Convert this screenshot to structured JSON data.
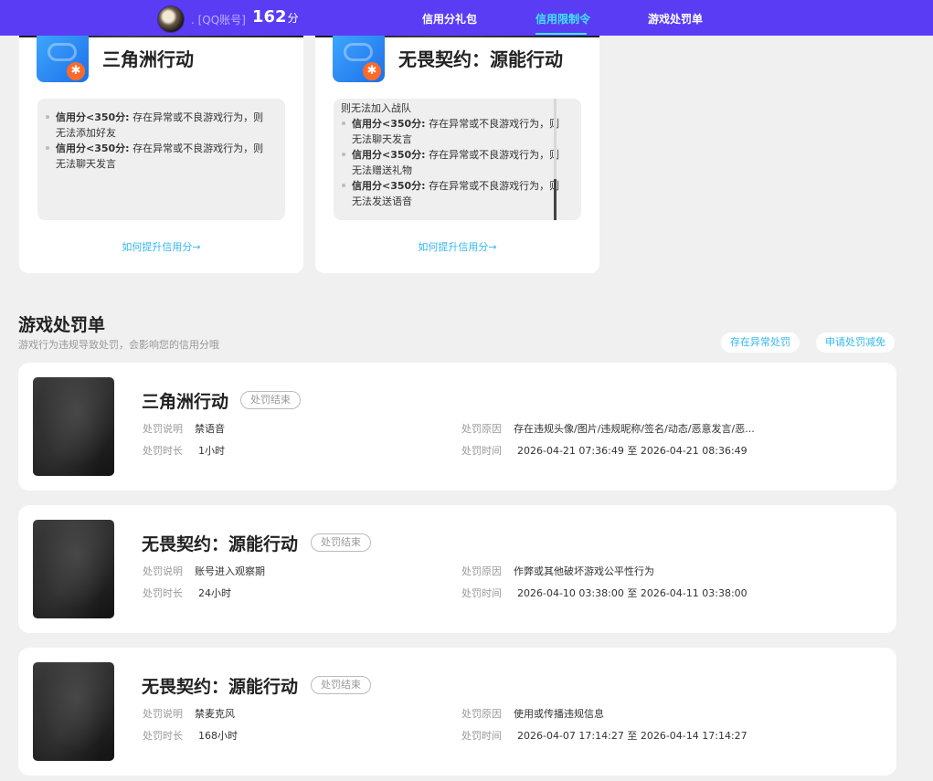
{
  "header": {
    "account_label": ". [QQ账号]",
    "score": "162",
    "score_unit": "分",
    "nav": [
      {
        "label": "信用分礼包",
        "active": false
      },
      {
        "label": "信用限制令",
        "active": true
      },
      {
        "label": "游戏处罚单",
        "active": false
      }
    ]
  },
  "game_cards": [
    {
      "title": "三角洲行动",
      "rules": [
        {
          "bold": "信用分<350分:",
          "text": "存在异常或不良游戏行为，则无法添加好友"
        },
        {
          "bold": "信用分<350分:",
          "text": "存在异常或不良游戏行为，则无法聊天发言"
        }
      ],
      "link": "如何提升信用分→"
    },
    {
      "title": "无畏契约：源能行动",
      "lead_text": "则无法加入战队",
      "rules": [
        {
          "bold": "信用分<350分:",
          "text": "存在异常或不良游戏行为，则无法聊天发言"
        },
        {
          "bold": "信用分<350分:",
          "text": "存在异常或不良游戏行为，则无法赠送礼物"
        },
        {
          "bold": "信用分<350分:",
          "text": "存在异常或不良游戏行为，则无法发送语音"
        }
      ],
      "link": "如何提升信用分→"
    }
  ],
  "penalty_section": {
    "title": "游戏处罚单",
    "subtitle": "游戏行为违规导致处罚，会影响您的信用分哦",
    "btn_abnormal": "存在异常处罚",
    "btn_appeal": "申请处罚减免",
    "labels": {
      "desc": "处罚说明",
      "duration": "处罚时长",
      "reason": "处罚原因",
      "time": "处罚时间"
    },
    "items": [
      {
        "game": "三角洲行动",
        "status": "处罚结束",
        "desc": "禁语音",
        "duration": "1小时",
        "reason": "存在违规头像/图片/违规昵称/签名/动态/恶意发言/恶...",
        "time": "2026-04-21 07:36:49 至 2026-04-21 08:36:49"
      },
      {
        "game": "无畏契约：源能行动",
        "status": "处罚结束",
        "desc": "账号进入观察期",
        "duration": "24小时",
        "reason": "作弊或其他破坏游戏公平性行为",
        "time": "2026-04-10 03:38:00 至 2026-04-11 03:38:00"
      },
      {
        "game": "无畏契约：源能行动",
        "status": "处罚结束",
        "desc": "禁麦克风",
        "duration": "168小时",
        "reason": "使用或传播违规信息",
        "time": "2026-04-07 17:14:27 至 2026-04-14 17:14:27"
      }
    ]
  }
}
